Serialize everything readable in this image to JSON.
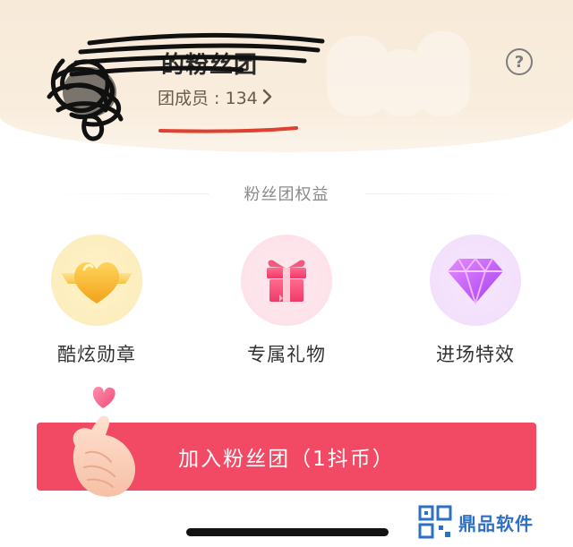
{
  "header": {
    "group_name": "的粉丝团",
    "members_label": "团成员 : 134",
    "help_label": "?"
  },
  "perks_section": {
    "title": "粉丝团权益",
    "items": [
      {
        "label": "酷炫勋章",
        "icon": "gold-heart-badge-icon"
      },
      {
        "label": "专属礼物",
        "icon": "gift-box-icon"
      },
      {
        "label": "进场特效",
        "icon": "diamond-icon"
      }
    ]
  },
  "join_button": {
    "label": "加入粉丝团（1抖币）"
  },
  "watermark": {
    "text": "鼎品软件"
  },
  "colors": {
    "accent": "#f24a64",
    "header_bg": "#f7ead9",
    "underline": "#e0402f",
    "watermark": "#2d6fc6"
  }
}
